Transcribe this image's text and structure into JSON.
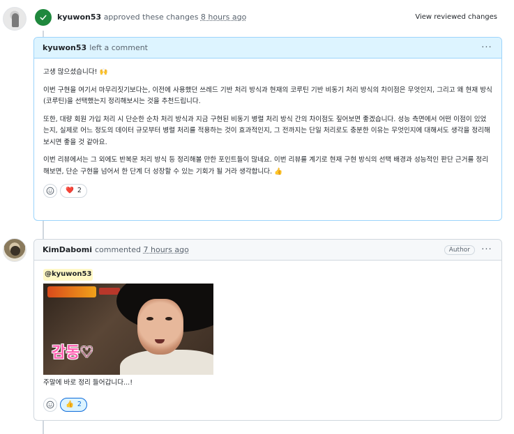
{
  "review": {
    "user": "kyuwon53",
    "action": "approved these changes",
    "time": "8 hours ago",
    "view_changes": "View reviewed changes"
  },
  "comment1": {
    "author": "kyuwon53",
    "header_action": "left a comment",
    "paragraphs": [
      "고생 많으셨습니다! 🙌",
      "이번 구현을 여기서 마무리짓기보다는, 이전에 사용했던 쓰레드 기반 처리 방식과 현재의 코루틴 기반 비동기 처리 방식의 차이점은 무엇인지, 그리고 왜 현재 방식(코루틴)을 선택했는지 정리해보시는 것을 추천드립니다.",
      "또한, 대량 회원 가입 처리 시 단순한 순차 처리 방식과 지금 구현된 비동기 병렬 처리 방식 간의 차이점도 짚어보면 좋겠습니다. 성능 측면에서 어떤 이점이 있었는지, 실제로 어느 정도의 데이터 규모부터 병렬 처리를 적용하는 것이 효과적인지, 그 전까지는 단일 처리로도 충분한 이유는 무엇인지에 대해서도 생각을 정리해보시면 좋을 것 같아요.",
      "이번 리뷰에서는 그 외에도 반복문 처리 방식 등 정리해볼 만한 포인트들이 많네요. 이번 리뷰를 계기로 현재 구현 방식의 선택 배경과 성능적인 판단 근거를 정리해보면, 단순 구현을 넘어서 한 단계 더 성장할 수 있는 기회가 될 거라 생각합니다. 👍"
    ],
    "reaction_emoji": "❤️",
    "reaction_count": "2"
  },
  "comment2": {
    "author": "KimDabomi",
    "header_action": "commented",
    "time": "7 hours ago",
    "badge": "Author",
    "mention": "@kyuwon53",
    "gif_caption": "감동♡",
    "body": "주말에 바로 정리 들어갑니다...!",
    "reaction_emoji": "👍",
    "reaction_count": "2"
  },
  "icons": {
    "approve": "check-circle-icon",
    "kebab": "kebab-horizontal-icon",
    "smiley": "smiley-add-reaction-icon"
  },
  "colors": {
    "approve_green": "#1f883d",
    "highlight_header": "#ddf4ff",
    "highlight_border": "#9cd4fb",
    "accent_blue": "#0969da",
    "mention_bg": "#fff8c5"
  }
}
